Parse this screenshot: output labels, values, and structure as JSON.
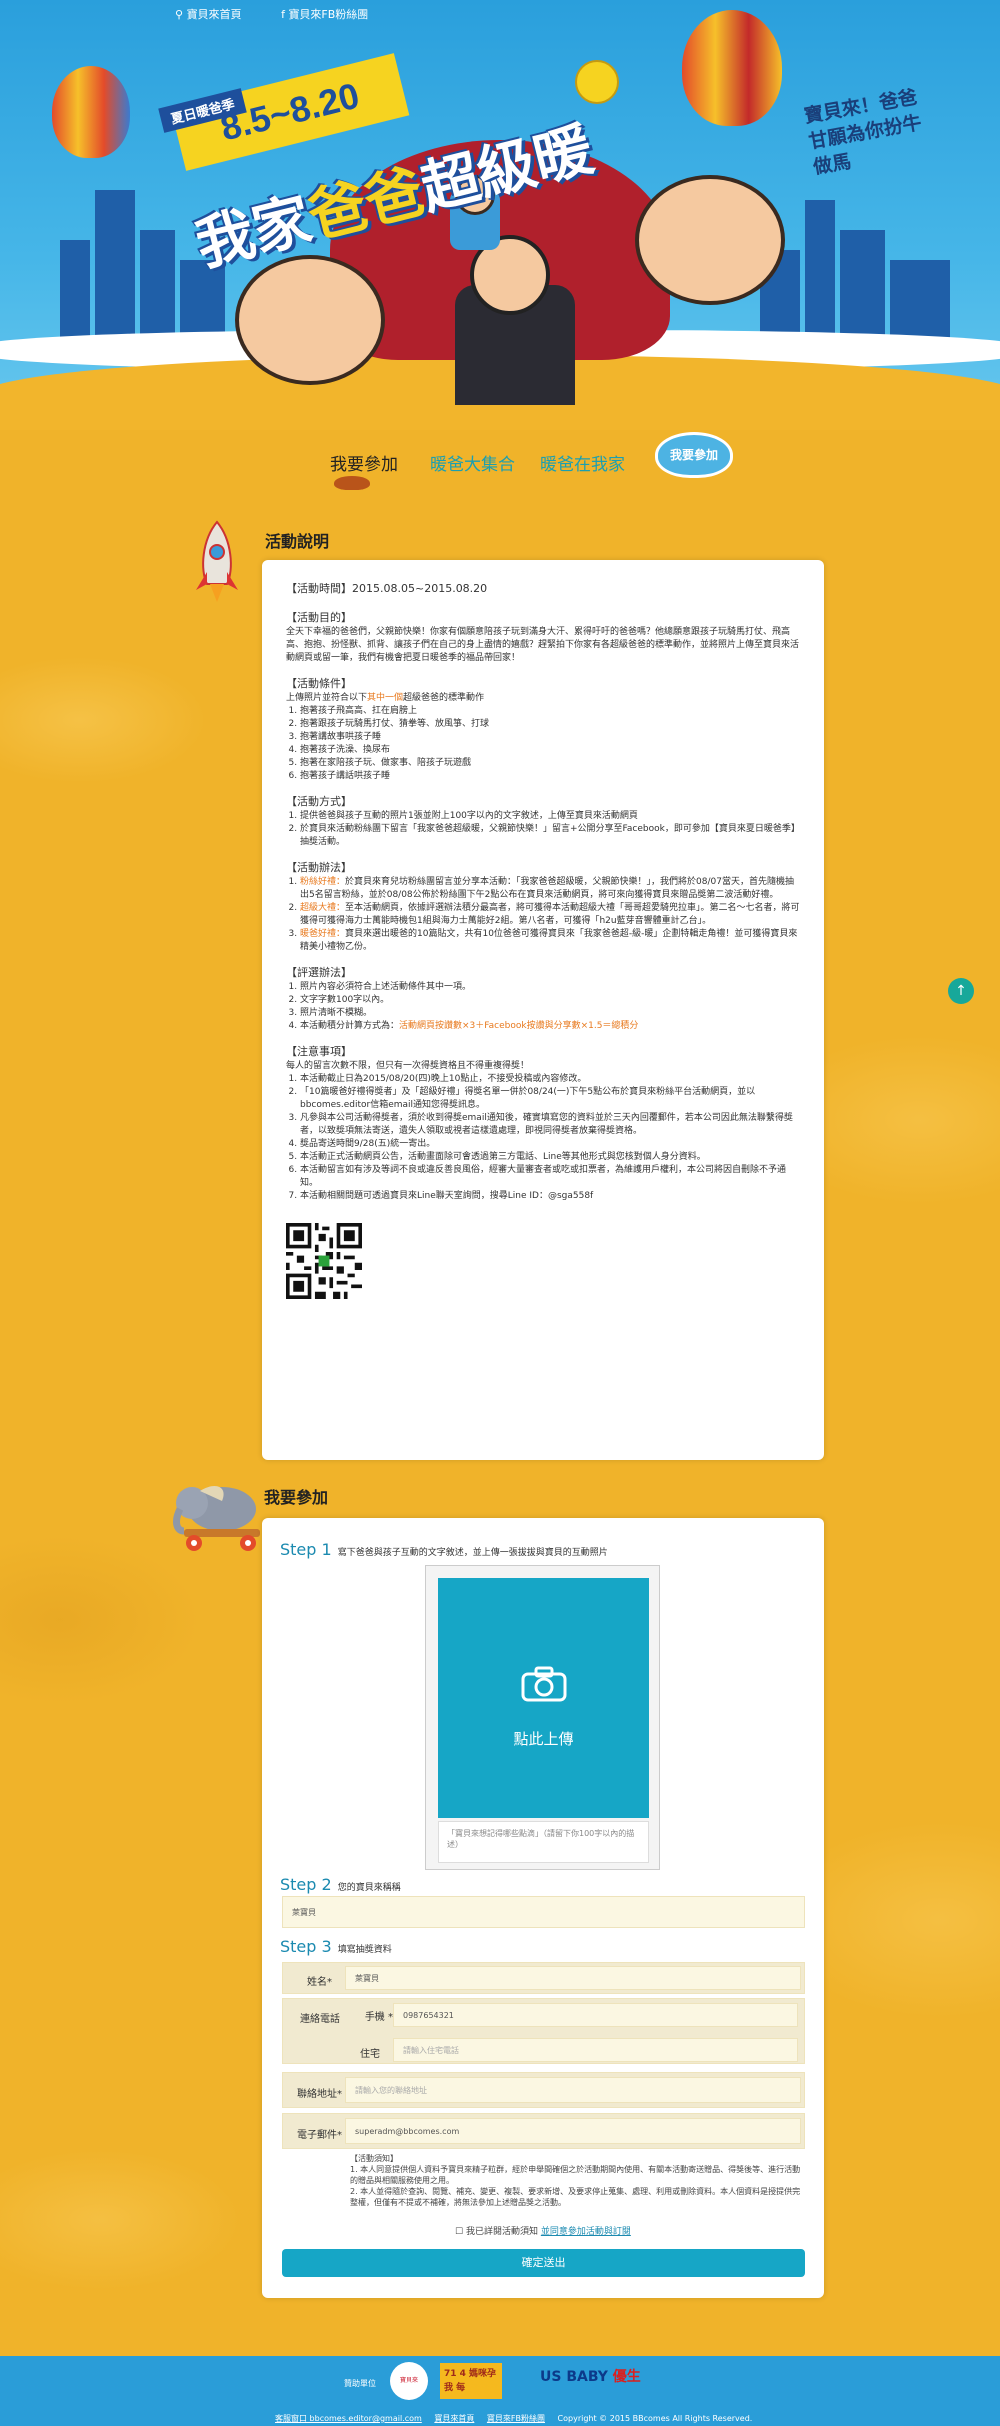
{
  "top_links": {
    "site": "寶貝來首頁",
    "fb": "寶貝來FB粉絲團"
  },
  "hero": {
    "tag": "夏日暖爸季",
    "date": "8.5~8.20",
    "title_a": "我家",
    "title_b": "爸爸",
    "title_c": "超級暖",
    "side_text": "寶貝來！爸爸甘願為你扮牛做馬"
  },
  "nav": {
    "items": [
      "我要參加",
      "暖爸大集合",
      "暖爸在我家"
    ],
    "bird": "我要參加"
  },
  "section1_title": "活動說明",
  "section2_title": "我要參加",
  "desc": {
    "period": "【活動時間】2015.08.05~2015.08.20",
    "purpose_h": "【活動目的】",
    "purpose": "全天下幸福的爸爸們，父親節快樂！你家有個願意陪孩子玩到滿身大汗、累得吁吁的爸爸嗎？他總願意跟孩子玩騎馬打仗、飛高高、抱抱、扮怪獸、抓背、讓孩子們在自己的身上盡情的嬉戲？趕緊拍下你家有各超級爸爸的標準動作，並將照片上傳至寶貝來活動網頁或留一筆，我們有機會把夏日暖爸季的福品帶回家！",
    "cond_h": "【活動條件】",
    "cond_intro_a": "上傳照片並符合以下",
    "cond_intro_hl": "其中一個",
    "cond_intro_b": "超級爸爸的標準動作",
    "cond": [
      "抱著孩子飛高高、扛在肩膀上",
      "抱著跟孩子玩騎馬打仗、猜拳等、放風箏、打球",
      "抱著講故事哄孩子睡",
      "抱著孩子洗澡、換尿布",
      "抱著在家陪孩子玩、做家事、陪孩子玩遊戲",
      "抱著孩子講話哄孩子睡"
    ],
    "method_h": "【活動方式】",
    "method": [
      "提供爸爸與孩子互動的照片1張並附上100字以內的文字敘述，上傳至寶貝來活動網頁",
      "於寶貝來活動粉絲團下留言「我家爸爸超級暖，父親節快樂！」留言+公開分享至Facebook，即可參加【寶貝來夏日暖爸季】抽獎活動。"
    ],
    "prize_h": "【活動辦法】",
    "prize": [
      {
        "hl": "粉絲好禮：",
        "text": "於寶貝來育兒坊粉絲團留言並分享本活動：「我家爸爸超級暖，父親節快樂！」，我們將於08/07當天，首先隨機抽出5名留言粉絲，並於08/08公佈於粉絲團下午2點公布在寶貝來活動網頁，將可來向獲得寶貝來贈品獎第二波活動好禮。"
      },
      {
        "hl": "超級大禮：",
        "text": "至本活動網頁，依據評選辦法積分最高者，將可獲得本活動超級大禮「哥哥超愛騎兜拉車」。第二名～七名者，將可獲得可獲得海力士萬能時機包1組與海力士萬能好2組。第八名者，可獲得「h2u藍芽音響體重計乙台」。"
      },
      {
        "hl": "暖爸好禮：",
        "text": "寶貝來選出暖爸的10篇貼文，共有10位爸爸可獲得寶貝來「我家爸爸超-級-暖」企劃特輯走角禮！並可獲得寶貝來精美小禮物乙份。"
      }
    ],
    "judge_h": "【評選辦法】",
    "judge": [
      "照片內容必須符合上述活動條件其中一項。",
      "文字字數100字以內。",
      "照片清晰不模糊。"
    ],
    "judge4_a": "本活動積分計算方式為：",
    "judge4_hl": "活動網頁按讚數×3＋Facebook按讚與分享數×1.5＝總積分",
    "notice_h": "【注意事項】",
    "notice_intro": "每人的留言次數不限，但只有一次得獎資格且不得重複得獎！",
    "notice": [
      "本活動截止日為2015/08/20(四)晚上10點止，不接受投稿或內容修改。",
      "「10篇暖爸好禮得獎者」及「超級好禮」得獎名單一併於08/24(一)下午5點公布於寶貝來粉絲平台活動網頁，並以bbcomes.editor信箱email通知您得獎訊息。",
      "凡參與本公司活動得獎者，須於收到得獎email通知後，確實填寫您的資料並於三天內回覆郵件，若本公司因此無法聯繫得獎者，以致獎項無法寄送，遺失人領取或視者這樣遺處理，即視同得獎者放棄得獎資格。",
      "獎品寄送時間9/28(五)統一寄出。",
      "本活動正式活動網頁公告，活動畫面除可會透過第三方電話、Line等其他形式與您核對個人身分資料。",
      "本活動留言如有涉及等詞不良或違反善良風俗，經審大量審查者或吃或扣票者，為維護用戶權利，本公司將因自刪除不予通知。",
      "本活動相關問題可透過寶貝來Line聯天室詢問，搜尋Line ID：@sga558f"
    ]
  },
  "form": {
    "step1": "Step 1",
    "step1_text": "寫下爸爸與孩子互動的文字敘述，並上傳一張拔拔與寶貝的互動照片",
    "upload_label": "點此上傳",
    "upload_placeholder": "「寶貝來想記得哪些點滴」（請留下你100字以內的描述）",
    "step2": "Step 2",
    "step2_text": "您的寶貝來稱稱",
    "nickname": "萊寶貝",
    "step3": "Step 3",
    "step3_text": "填寫抽獎資料",
    "name_label": "姓名*",
    "name_value": "萊寶貝",
    "phone_label": "連絡電話",
    "mobile_label": "手機 *",
    "mobile_value": "0987654321",
    "home_label": "住宅",
    "home_placeholder": "請輸入住宅電話",
    "address_label": "聯絡地址*",
    "address_placeholder": "請輸入您的聯絡地址",
    "email_label": "電子郵件*",
    "email_value": "superadm@bbcomes.com",
    "note_title": "【活動須知】",
    "note_1": "1. 本人同意提供個人資料予寶貝來精子粒群，經於申舉間確個之於活動期間內使用、有關本活動寄送贈品、得獎後等、進行活動的贈品與相關服務使用之用。",
    "note_2": "2. 本人並得隨於查詢、閱覽、補充、變更、複製、要求新增、及要求停止蒐集、處理、利用或刪除資料。本人個資料是授提供完整權，但僅有不提或不補確，將無法參加上述贈品獎之活動。",
    "agree_text": "我已詳閱活動須知",
    "agree_link": "並同意參加活動與訂閱",
    "submit": "確定送出"
  },
  "footer": {
    "sponsor": "贊助單位",
    "logo_a": "寶貝來",
    "logo_b": "71 4 媽咪孕 我 每",
    "logo_c_a": "US BABY",
    "logo_c_b": "優生",
    "contact": "客服窗口 bbcomes.editor@gmail.com",
    "link1": "寶貝來首頁",
    "link2": "寶貝來FB粉絲團",
    "copyright": "Copyright © 2015 BBcomes All Rights Reserved."
  }
}
